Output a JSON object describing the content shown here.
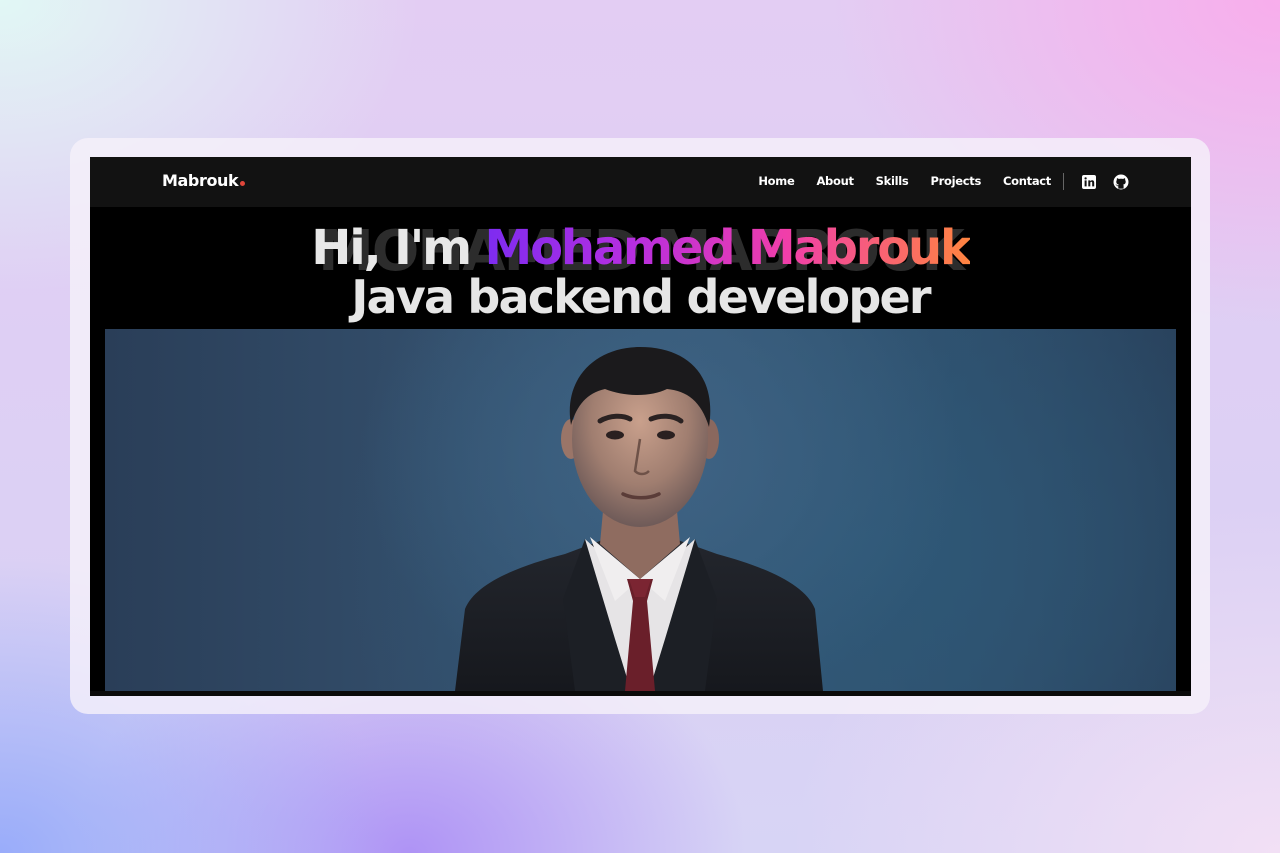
{
  "brand": {
    "name": "Mabrouk",
    "accent_color": "#e0463a"
  },
  "nav": {
    "links": [
      {
        "label": "Home"
      },
      {
        "label": "About"
      },
      {
        "label": "Skills"
      },
      {
        "label": "Projects"
      },
      {
        "label": "Contact"
      }
    ],
    "social": [
      {
        "icon": "linkedin-icon"
      },
      {
        "icon": "github-icon"
      }
    ]
  },
  "hero": {
    "background_word": "MOHAMED MABROUK",
    "greeting": "Hi, I'm ",
    "name": "Mohamed Mabrouk",
    "role": "Java backend developer",
    "name_gradient": [
      "#7d2cf0",
      "#b62ee0",
      "#f03eaa",
      "#ff8440"
    ]
  },
  "photo": {
    "subject": "portrait-photo"
  }
}
